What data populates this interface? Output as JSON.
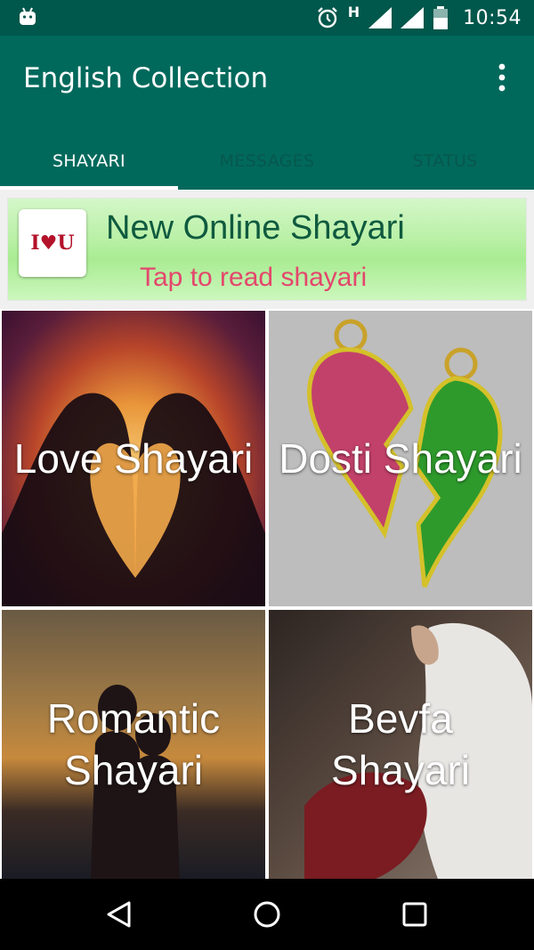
{
  "status_bar": {
    "time": "10:54",
    "network_letter": "H",
    "icons": [
      "android-icon",
      "alarm-icon",
      "signal-icon",
      "signal-icon",
      "battery-icon"
    ]
  },
  "app_bar": {
    "title": "English Collection",
    "overflow_icon": "more-vert-icon"
  },
  "tabs": [
    {
      "label": "SHAYARI",
      "active": true
    },
    {
      "label": "MESSAGES",
      "active": false
    },
    {
      "label": "STATUS",
      "active": false
    }
  ],
  "banner": {
    "logo_text": "I♥U",
    "headline": "New Online Shayari",
    "subtitle": "Tap to read shayari"
  },
  "categories": [
    {
      "label": "Love Shayari"
    },
    {
      "label": "Dosti Shayari"
    },
    {
      "label": "Romantic Shayari"
    },
    {
      "label": "Bevfa Shayari"
    }
  ],
  "nav_bar": {
    "icons": [
      "back-icon",
      "home-icon",
      "recents-icon"
    ]
  },
  "colors": {
    "status_bar": "#00574b",
    "app_bar": "#00695c",
    "banner_headline": "#0f5a3f",
    "banner_subtitle": "#e4466d"
  }
}
